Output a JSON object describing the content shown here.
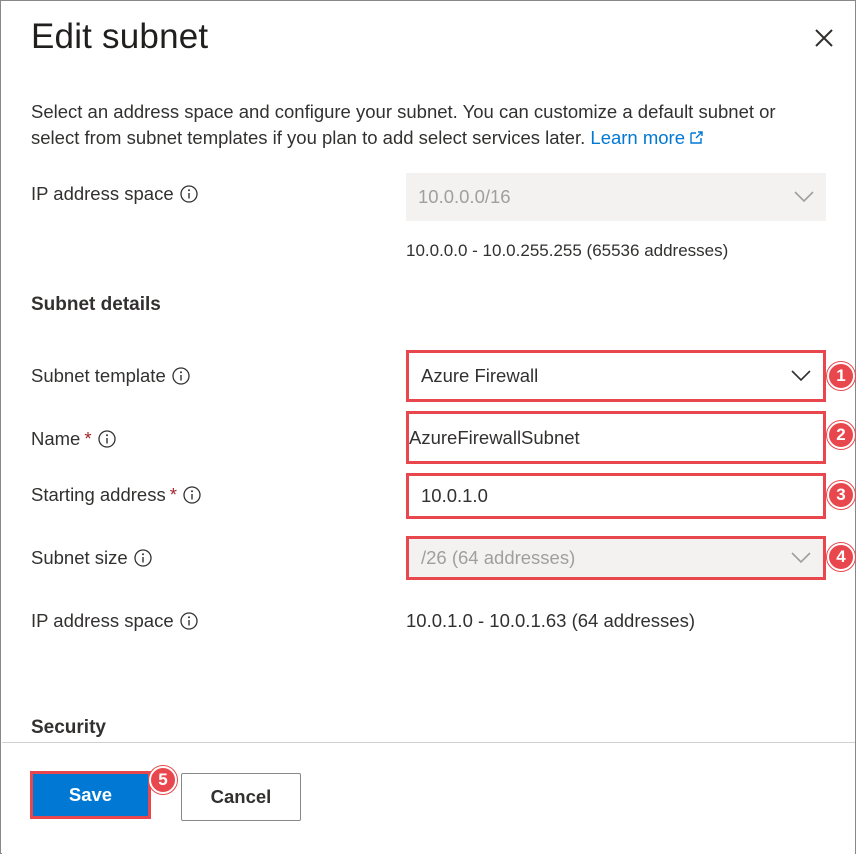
{
  "panel": {
    "title": "Edit subnet",
    "description": "Select an address space and configure your subnet. You can customize a default subnet or select from subnet templates if you plan to add select services later.",
    "learn_more": "Learn more"
  },
  "ip_space": {
    "label": "IP address space",
    "value": "10.0.0.0/16",
    "range": "10.0.0.0 - 10.0.255.255 (65536 addresses)"
  },
  "subnet_details": {
    "heading": "Subnet details",
    "template": {
      "label": "Subnet template",
      "value": "Azure Firewall",
      "badge": "1"
    },
    "name": {
      "label": "Name",
      "required": "*",
      "value": "AzureFirewallSubnet",
      "badge": "2"
    },
    "starting_address": {
      "label": "Starting address",
      "required": "*",
      "value": "10.0.1.0",
      "badge": "3"
    },
    "size": {
      "label": "Subnet size",
      "value": "/26 (64 addresses)",
      "badge": "4"
    },
    "ip_space": {
      "label": "IP address space",
      "value": "10.0.1.0 - 10.0.1.63 (64 addresses)"
    }
  },
  "security": {
    "heading": "Security"
  },
  "footer": {
    "save_label": "Save",
    "save_badge": "5",
    "cancel_label": "Cancel"
  },
  "icons": {
    "close": "close-icon",
    "info": "info-icon",
    "chevron": "chevron-down-icon",
    "external": "external-link-icon"
  },
  "colors": {
    "accent": "#0078d4",
    "highlight": "#e8474d",
    "required": "#a4262c",
    "disabled_bg": "#f3f2f1"
  }
}
